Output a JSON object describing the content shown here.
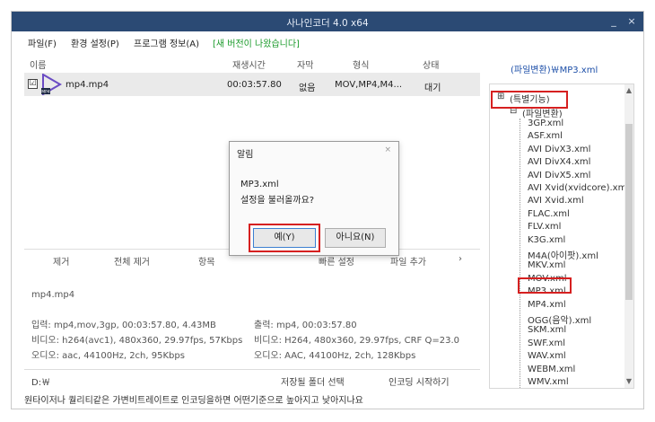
{
  "window": {
    "title": "사나인코더 4.0 x64",
    "min_glyph": "_",
    "close_glyph": "×"
  },
  "menu": {
    "file": "파일(F)",
    "settings": "환경 설정(P)",
    "info": "프로그램 정보(A)",
    "new_version": "[새 버전이 나왔습니다]"
  },
  "file_list": {
    "columns": [
      "이름",
      "재생시간",
      "자막",
      "형식",
      "상태"
    ],
    "rows": [
      {
        "checked": "☑",
        "name": "mp4.mp4",
        "duration": "00:03:57.80",
        "subtitle": "없음",
        "format": "MOV,MP4,M4...",
        "status": "대기"
      }
    ]
  },
  "toolbar": {
    "remove": "제거",
    "remove_all": "전체 제거",
    "item": "항목",
    "quick_settings": "빠른 설정",
    "add_file": "파일 추가",
    "more": "›"
  },
  "info": {
    "filename": "mp4.mp4",
    "input": "입력: mp4,mov,3gp, 00:03:57.80, 4.43MB",
    "output": "출력: mp4, 00:03:57.80",
    "video_in": "비디오: h264(avc1), 480x360, 29.97fps, 57Kbps",
    "video_out": "비디오: H264, 480x360, 29.97fps, CRF Q=23.0",
    "audio_in": "오디오: aac, 44100Hz, 2ch, 95Kbps",
    "audio_out": "오디오: AAC, 44100Hz, 2ch, 128Kbps"
  },
  "bottom": {
    "path": "D:￦",
    "select_folder": "저장될 폴더 선택",
    "start_encoding": "인코딩 시작하기"
  },
  "status": "원타이저나 퀄리티같은 가변비트레이트로 인코딩을하면 어떤기준으로 높아지고 낮아지나요",
  "tree": {
    "path": "(파일변환)￦MP3.xml",
    "collapsed_group": "(특별기능)",
    "expanded_group": "(파일변환)",
    "expand_minus": "⊟",
    "collapse_plus": "⊞",
    "items": [
      "3GP.xml",
      "ASF.xml",
      "AVI DivX3.xml",
      "AVI DivX4.xml",
      "AVI DivX5.xml",
      "AVI Xvid(xvidcore).xml",
      "AVI Xvid.xml",
      "FLAC.xml",
      "FLV.xml",
      "K3G.xml",
      "M4A(아이팟).xml",
      "MKV.xml",
      "MOV.xml",
      "MP3.xml",
      "MP4.xml",
      "OGG(음악).xml",
      "SKM.xml",
      "SWF.xml",
      "WAV.xml",
      "WEBM.xml",
      "WMV.xml"
    ],
    "scroll_up": "▲",
    "scroll_down": "▼"
  },
  "dialog": {
    "title": "알림",
    "close": "×",
    "line1": "MP3.xml",
    "line2": "설정을 불러올까요?",
    "yes": "예(Y)",
    "no": "아니요(N)"
  },
  "colors": {
    "titlebar": "#2b4a74",
    "highlight_red": "#d62020",
    "new_version_green": "#1a9a2a",
    "tree_path_blue": "#1d4fa8"
  },
  "icons": {
    "file": "play-video-icon"
  }
}
